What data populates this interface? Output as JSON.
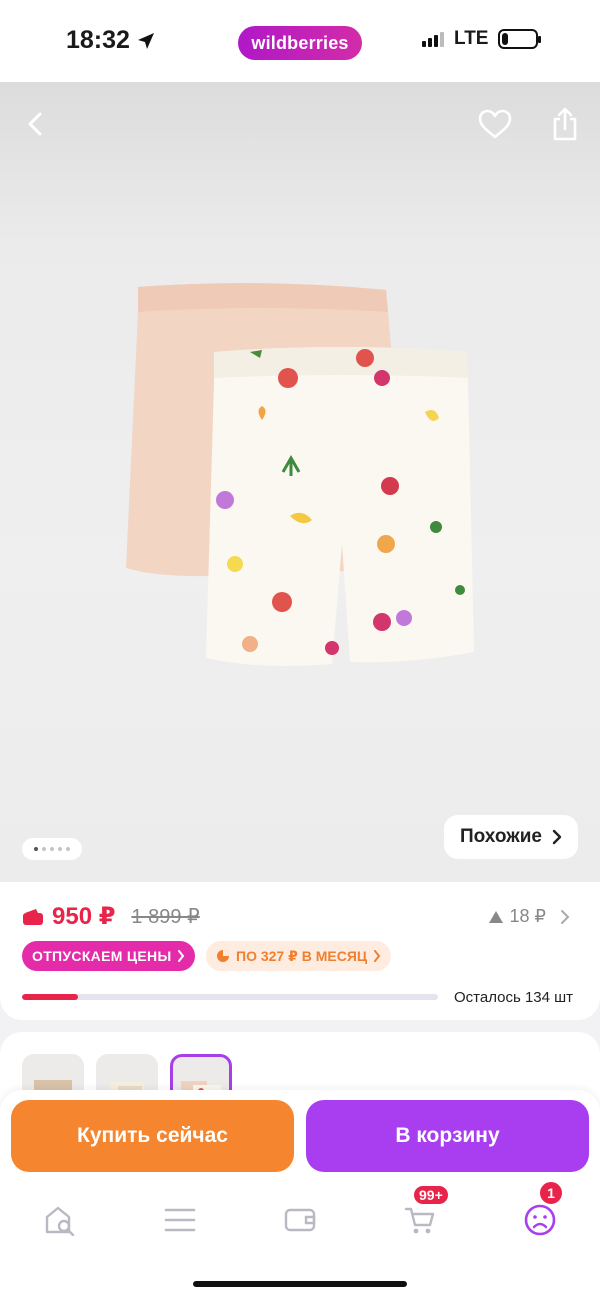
{
  "status_bar": {
    "time": "18:32",
    "brand": "wildberries",
    "network": "LTE",
    "battery_percent": 20
  },
  "gallery": {
    "similar_label": "Похожие",
    "image_count": 5,
    "active_index": 0,
    "icons": [
      "back-icon",
      "heart-icon",
      "share-icon"
    ]
  },
  "price": {
    "current": "950 ₽",
    "old": "1 899 ₽",
    "points": "18 ₽",
    "tag_sale": "ОТПУСКАЕМ ЦЕНЫ",
    "tag_installment": "ПО 327 ₽ В МЕСЯЦ",
    "stock_text": "Осталось 134 шт",
    "stock_fill_fraction": 0.135,
    "accent_color": "#e8244b"
  },
  "actions": {
    "buy_now": "Купить сейчас",
    "add_to_cart": "В корзину",
    "buy_color": "#f5852e",
    "cart_color": "#a83ef0"
  },
  "tabbar": {
    "items": [
      "home-search-icon",
      "menu-icon",
      "wallet-icon",
      "cart-icon",
      "profile-icon"
    ],
    "cart_badge": "99+",
    "profile_badge": "1"
  }
}
